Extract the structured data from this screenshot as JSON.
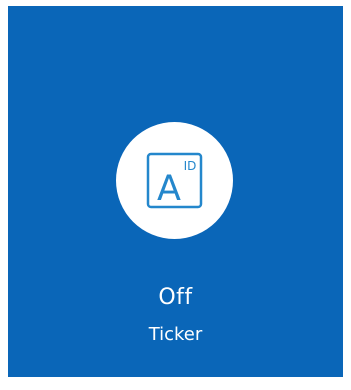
{
  "tile": {
    "icon": {
      "name": "ticker-id-icon",
      "letter": "A",
      "superscript": "ID"
    },
    "state": "Off",
    "name": "Ticker"
  },
  "colors": {
    "tile_background": "#0a66b8",
    "icon_background": "#ffffff",
    "icon_accent": "#2487cc",
    "text": "#ffffff"
  }
}
